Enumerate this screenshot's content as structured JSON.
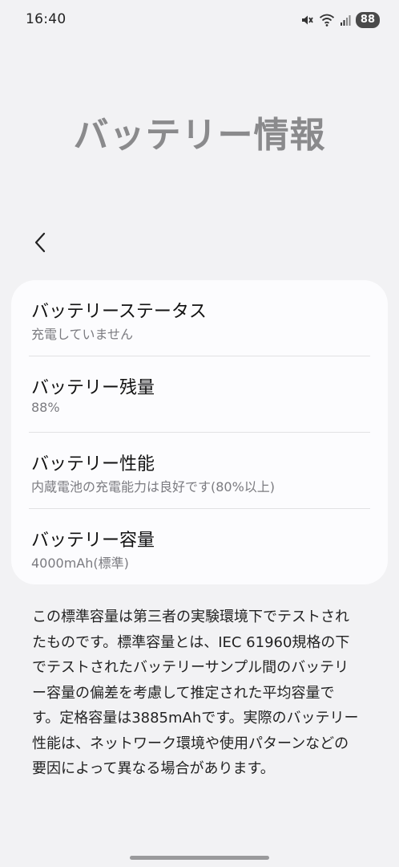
{
  "status_bar": {
    "time": "16:40",
    "battery_level": "88"
  },
  "page": {
    "title": "バッテリー情報"
  },
  "items": [
    {
      "title": "バッテリーステータス",
      "subtitle": "充電していません"
    },
    {
      "title": "バッテリー残量",
      "subtitle": "88%"
    },
    {
      "title": "バッテリー性能",
      "subtitle": "内蔵電池の充電能力は良好です(80%以上)"
    },
    {
      "title": "バッテリー容量",
      "subtitle": "4000mAh(標準)"
    }
  ],
  "footnote": "この標準容量は第三者の実験環境下でテストされ\nたものです。標準容量とは、IEC 61960規格の下\nでテストされたバッテリーサンプル間のバッテリ\nー容量の偏差を考慮して推定された平均容量で\nす。定格容量は3885mAhです。実際のバッテリー\n性能は、ネットワーク環境や使用パターンなどの\n要因によって異なる場合があります。",
  "icons": {
    "mute": "mute-icon",
    "wifi": "wifi-icon",
    "signal": "signal-icon",
    "back": "back-arrow-icon"
  }
}
